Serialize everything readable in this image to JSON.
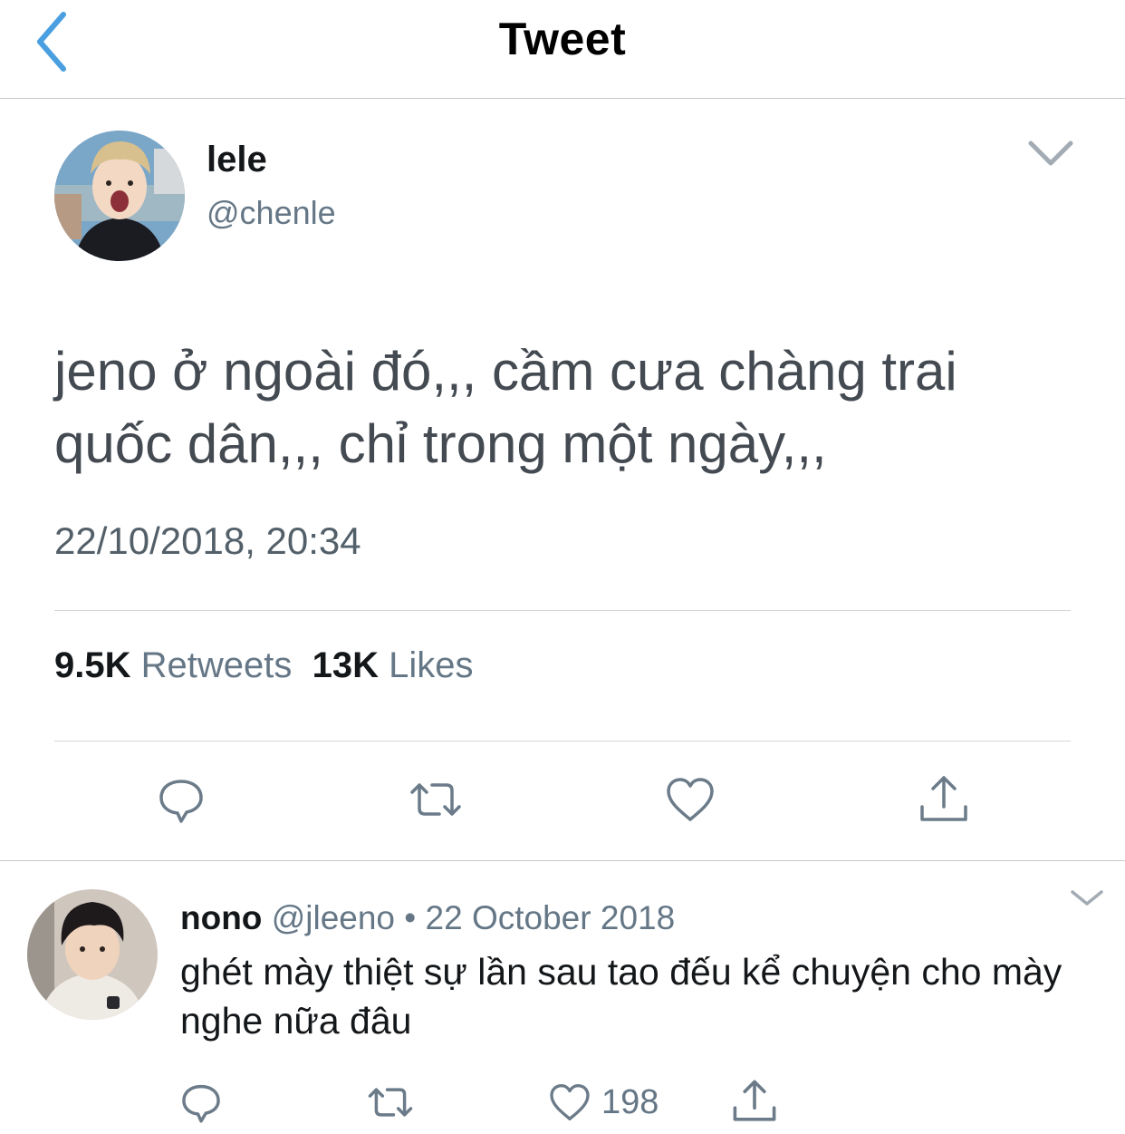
{
  "header": {
    "title": "Tweet",
    "back_icon": "chevron-left-icon"
  },
  "main_tweet": {
    "name": "lele",
    "handle": "@chenle",
    "text": "jeno ở ngoài đó,,, cầm cưa chàng trai quốc dân,,, chỉ trong một ngày,,,",
    "timestamp": "22/10/2018, 20:34",
    "retweets_count": "9.5K",
    "retweets_label": "Retweets",
    "likes_count": "13K",
    "likes_label": "Likes",
    "actions": [
      "reply-icon",
      "retweet-icon",
      "heart-icon",
      "share-icon"
    ]
  },
  "reply": {
    "name": "nono",
    "handle": "@jleeno",
    "separator": "•",
    "date": "22 October 2018",
    "text": "ghét mày thiệt sự lần sau tao đếu kể chuyện cho mày nghe nữa đâu",
    "like_count": "198"
  },
  "colors": {
    "accent": "#4a9fe0",
    "secondary_text": "#657786",
    "icon": "#6b7b89",
    "divider": "#d4d6d8"
  }
}
